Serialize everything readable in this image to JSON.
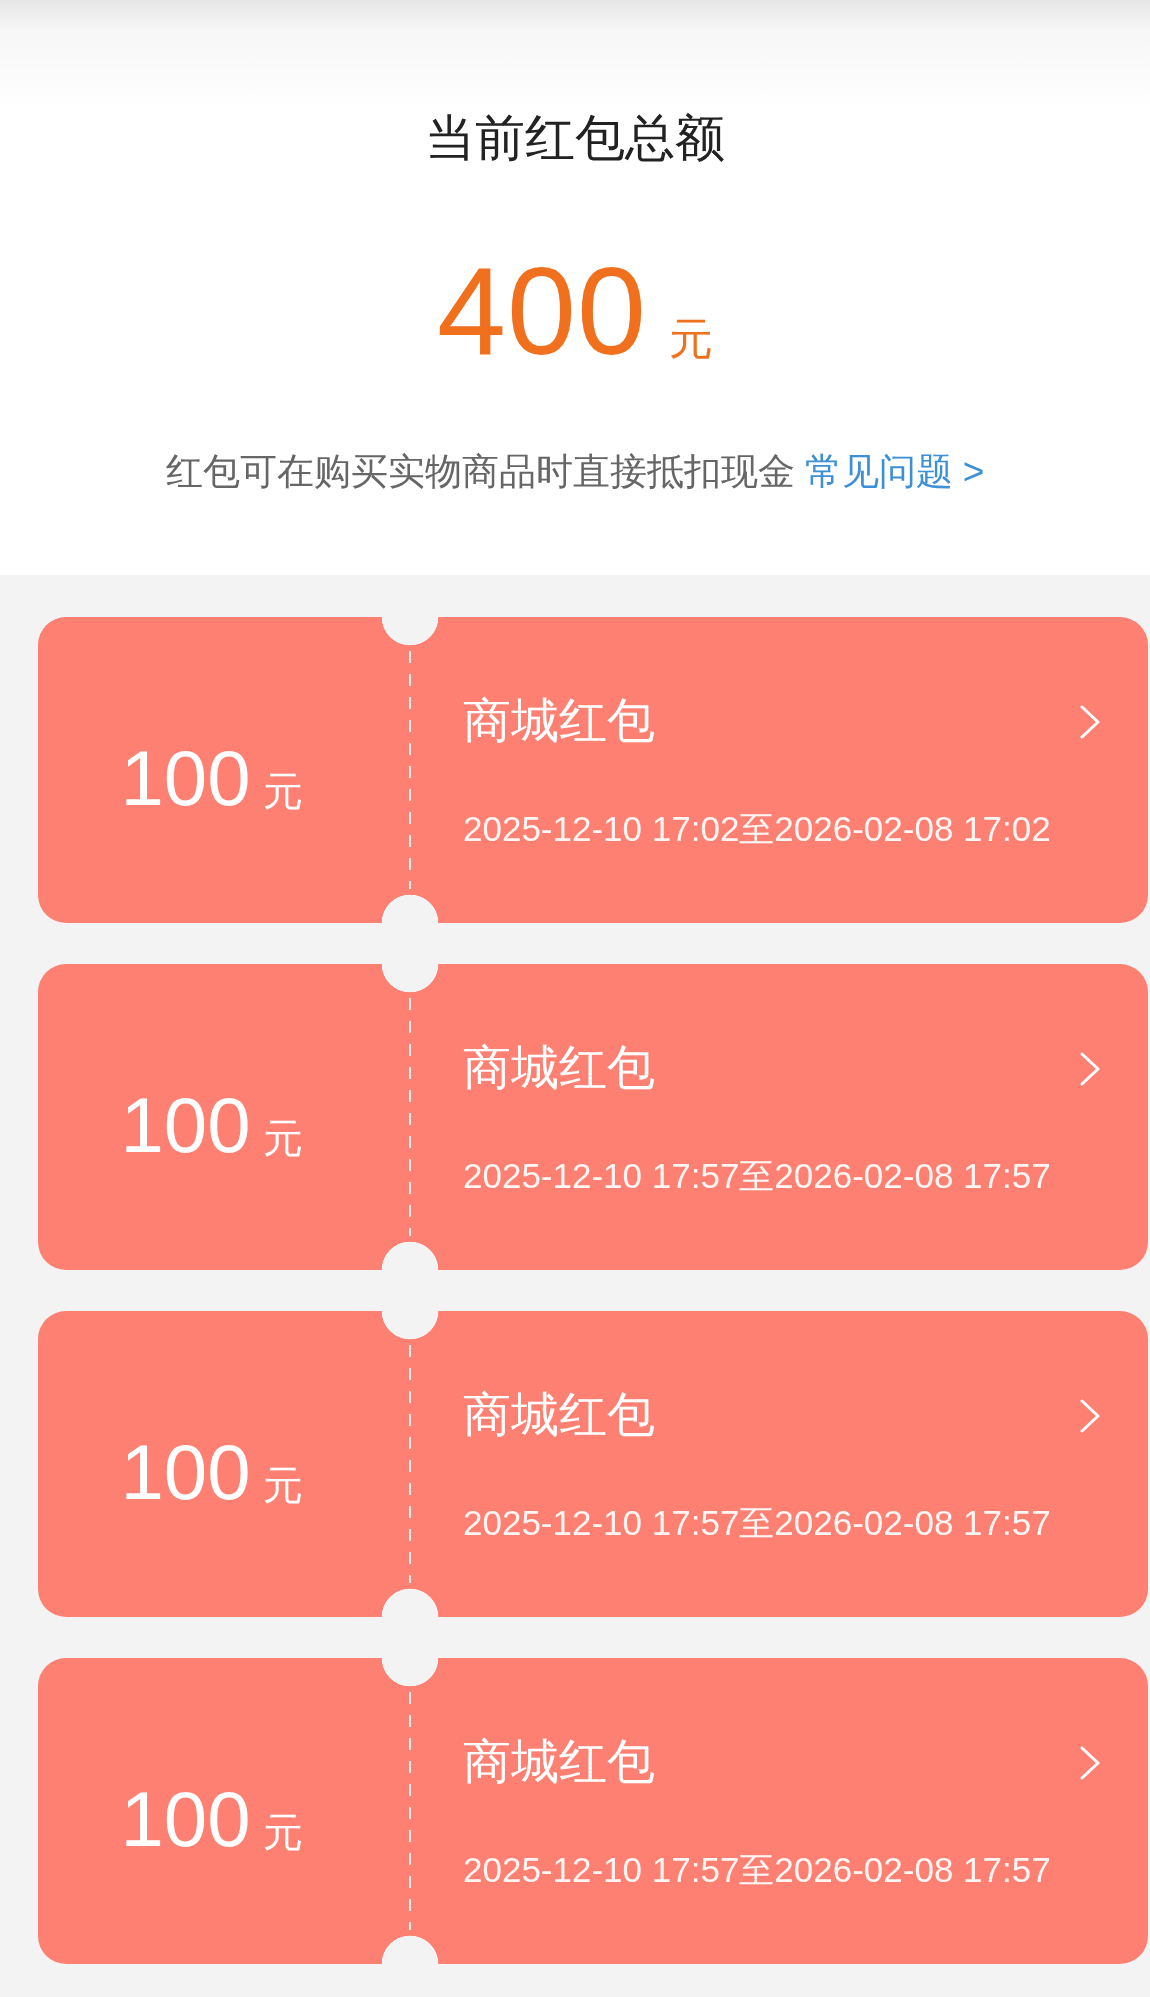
{
  "summary": {
    "title": "当前红包总额",
    "amount": "400",
    "unit": "元",
    "note": "红包可在购买实物商品时直接抵扣现金",
    "faq_link": "常见问题 >"
  },
  "coupons": [
    {
      "amount": "100",
      "unit": "元",
      "name": "商城红包",
      "validity": "2025-12-10 17:02至2026-02-08 17:02"
    },
    {
      "amount": "100",
      "unit": "元",
      "name": "商城红包",
      "validity": "2025-12-10 17:57至2026-02-08 17:57"
    },
    {
      "amount": "100",
      "unit": "元",
      "name": "商城红包",
      "validity": "2025-12-10 17:57至2026-02-08 17:57"
    },
    {
      "amount": "100",
      "unit": "元",
      "name": "商城红包",
      "validity": "2025-12-10 17:57至2026-02-08 17:57"
    }
  ]
}
